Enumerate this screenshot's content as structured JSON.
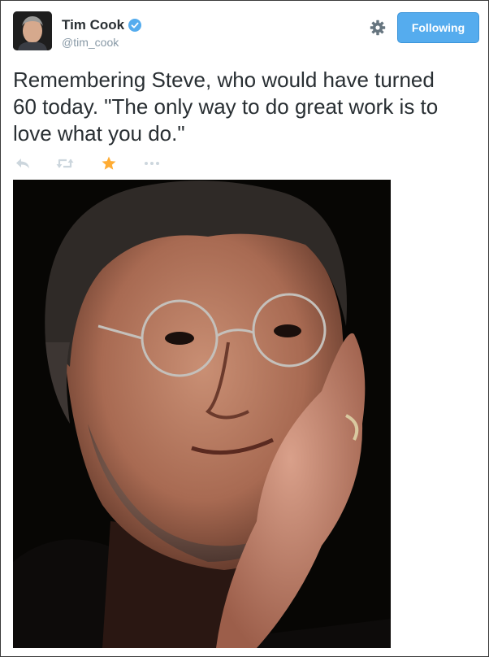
{
  "author": {
    "display_name": "Tim Cook",
    "handle": "@tim_cook",
    "verified": true,
    "avatar_icon": "profile-photo-avatar"
  },
  "header_actions": {
    "settings_icon": "gear-icon",
    "follow_button_label": "Following"
  },
  "tweet": {
    "text": "Remembering Steve, who would have turned\n60 today. \"The only way to do great work is to\nlove what you do.\""
  },
  "tweet_actions": [
    {
      "name": "reply-icon"
    },
    {
      "name": "retweet-icon"
    },
    {
      "name": "favorite-star-icon",
      "active": true
    },
    {
      "name": "more-options-icon"
    }
  ],
  "colors": {
    "text": "#292f33",
    "muted": "#8899a6",
    "accent": "#55acee",
    "favorite": "#ffac33",
    "action_icon": "#ccd6dd"
  },
  "media": {
    "type": "photo",
    "subject": "portrait-photo"
  }
}
